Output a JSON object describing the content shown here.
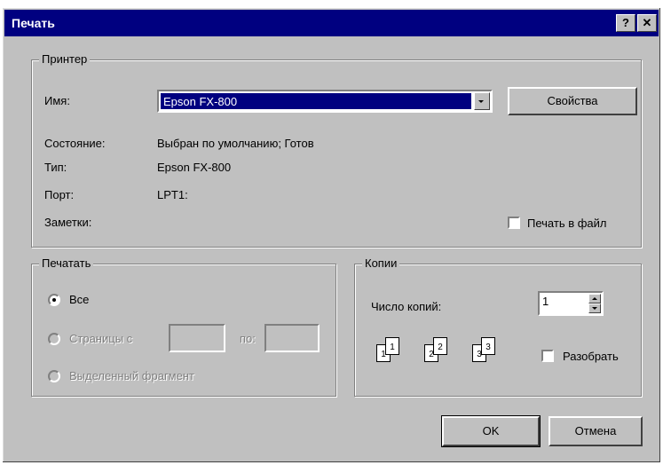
{
  "window": {
    "title": "Печать",
    "help_label": "?",
    "close_label": "✕"
  },
  "printer": {
    "group_label": "Принтер",
    "name_label": "Имя:",
    "name_value": "Epson FX-800",
    "properties_label": "Свойства",
    "status_label": "Состояние:",
    "status_value": "Выбран по умолчанию; Готов",
    "type_label": "Тип:",
    "type_value": "Epson FX-800",
    "port_label": "Порт:",
    "port_value": "LPT1:",
    "notes_label": "Заметки:",
    "print_to_file_label": "Печать в файл",
    "print_to_file_checked": false
  },
  "range": {
    "group_label": "Печатать",
    "all_label": "Все",
    "pages_label": "Страницы с",
    "to_label": "по:",
    "selection_label": "Выделенный фрагмент"
  },
  "copies": {
    "group_label": "Копии",
    "count_label": "Число копий:",
    "count_value": "1",
    "collate_label": "Разобрать",
    "collate_checked": false,
    "page_labels": [
      "1",
      "1",
      "2",
      "2",
      "3",
      "3"
    ]
  },
  "buttons": {
    "ok": "OK",
    "cancel": "Отмена"
  }
}
